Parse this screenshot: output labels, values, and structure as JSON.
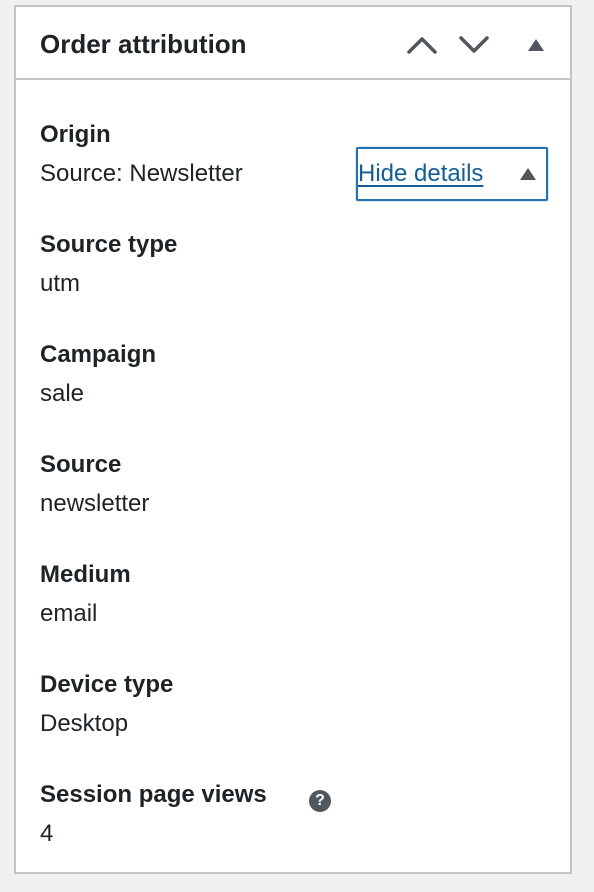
{
  "panel": {
    "title": "Order attribution",
    "move_up_label": "Move up",
    "move_down_label": "Move down",
    "toggle_panel_label": "Toggle panel"
  },
  "origin": {
    "label": "Origin",
    "value": "Source: Newsletter",
    "toggle_details_label": "Hide details"
  },
  "details": [
    {
      "label": "Source type",
      "value": "utm"
    },
    {
      "label": "Campaign",
      "value": "sale"
    },
    {
      "label": "Source",
      "value": "newsletter"
    },
    {
      "label": "Medium",
      "value": "email"
    },
    {
      "label": "Device type",
      "value": "Desktop"
    },
    {
      "label": "Session page views",
      "value": "4"
    }
  ],
  "help_tip": {
    "glyph": "?"
  },
  "icons": {
    "move_up": "chevron-up-icon",
    "move_down": "chevron-down-icon",
    "toggle": "triangle-up-icon",
    "details_toggle": "triangle-up-icon",
    "help": "question-mark-icon"
  },
  "colors": {
    "panel_border": "#c3c4c7",
    "text": "#1d2327",
    "link": "#135e96",
    "focus": "#2271b1",
    "icon": "#50575e",
    "background": "#f0f0f1"
  }
}
